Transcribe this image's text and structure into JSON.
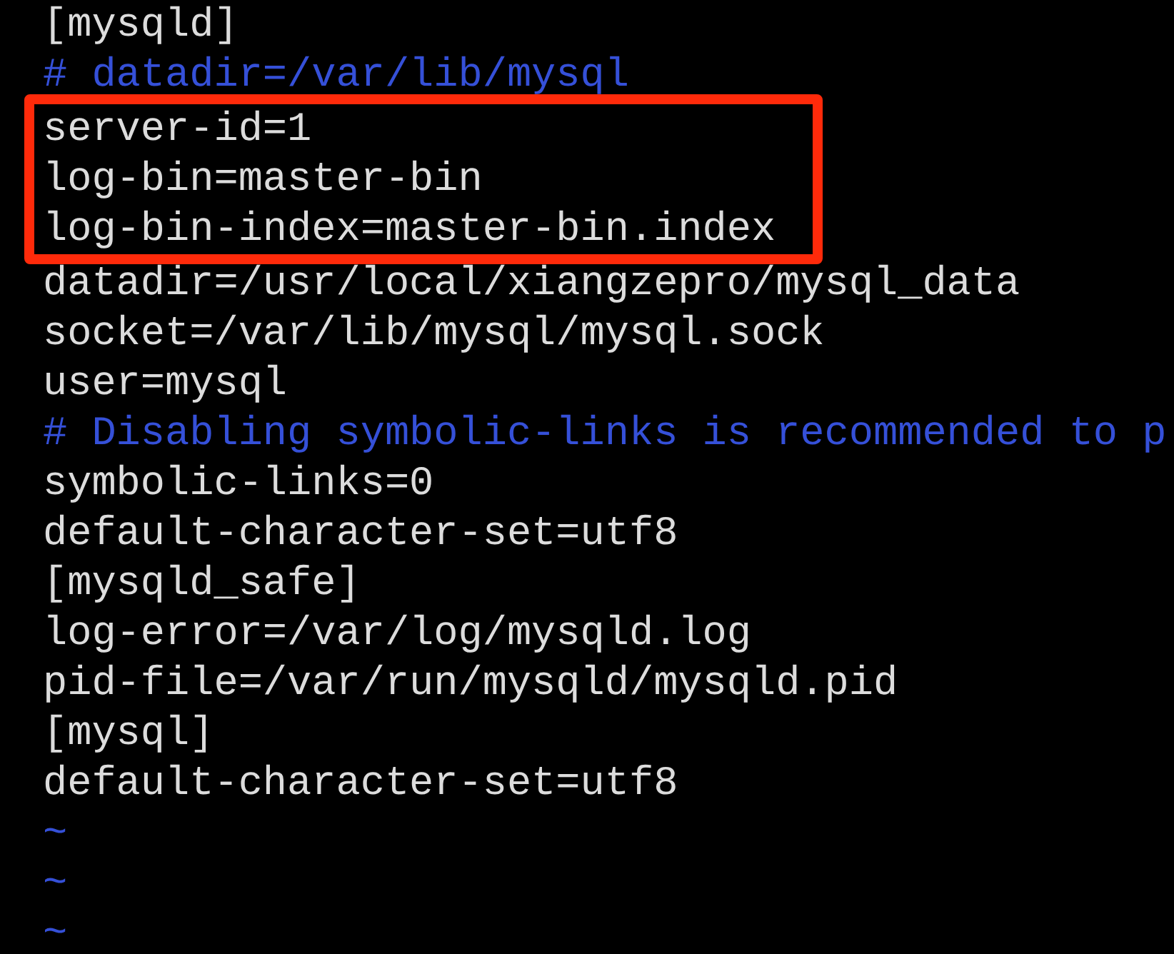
{
  "editor": {
    "lines": [
      {
        "kind": "setting",
        "text": "[mysqld]",
        "highlighted": false
      },
      {
        "kind": "comment",
        "text": "# datadir=/var/lib/mysql",
        "highlighted": false
      },
      {
        "kind": "setting",
        "text": "server-id=1",
        "highlighted": true
      },
      {
        "kind": "setting",
        "text": "log-bin=master-bin",
        "highlighted": true
      },
      {
        "kind": "setting",
        "text": "log-bin-index=master-bin.index",
        "highlighted": true
      },
      {
        "kind": "setting",
        "text": "datadir=/usr/local/xiangzepro/mysql_data",
        "highlighted": false
      },
      {
        "kind": "setting",
        "text": "socket=/var/lib/mysql/mysql.sock",
        "highlighted": false
      },
      {
        "kind": "setting",
        "text": "user=mysql",
        "highlighted": false
      },
      {
        "kind": "comment",
        "text": "# Disabling symbolic-links is recommended to p",
        "highlighted": false
      },
      {
        "kind": "setting",
        "text": "symbolic-links=0",
        "highlighted": false
      },
      {
        "kind": "setting",
        "text": "default-character-set=utf8",
        "highlighted": false
      },
      {
        "kind": "setting",
        "text": "[mysqld_safe]",
        "highlighted": false
      },
      {
        "kind": "setting",
        "text": "log-error=/var/log/mysqld.log",
        "highlighted": false
      },
      {
        "kind": "setting",
        "text": "pid-file=/var/run/mysqld/mysqld.pid",
        "highlighted": false
      },
      {
        "kind": "setting",
        "text": "[mysql]",
        "highlighted": false
      },
      {
        "kind": "setting",
        "text": "default-character-set=utf8",
        "highlighted": false
      },
      {
        "kind": "empty",
        "text": "~",
        "highlighted": false
      },
      {
        "kind": "empty",
        "text": "~",
        "highlighted": false
      },
      {
        "kind": "empty",
        "text": "~",
        "highlighted": false
      }
    ]
  }
}
